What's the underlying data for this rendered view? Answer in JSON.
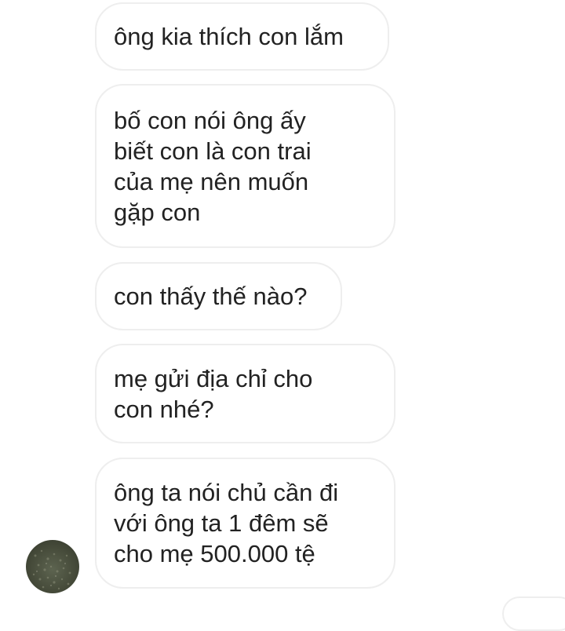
{
  "messages": [
    {
      "text": "ông kia thích con lắm"
    },
    {
      "text": "bố con nói ông ấy\nbiết con là con trai\ncủa mẹ nên muốn\ngặp con"
    },
    {
      "text": "con thấy thế nào?"
    },
    {
      "text": "mẹ gửi địa chỉ cho\ncon nhé?"
    },
    {
      "text": "ông ta nói chủ cần đi\nvới ông ta 1 đêm sẽ\ncho mẹ 500.000 tệ"
    }
  ],
  "colors": {
    "bubble_border": "#eeeeee",
    "bubble_text": "#222222",
    "background": "#ffffff"
  }
}
